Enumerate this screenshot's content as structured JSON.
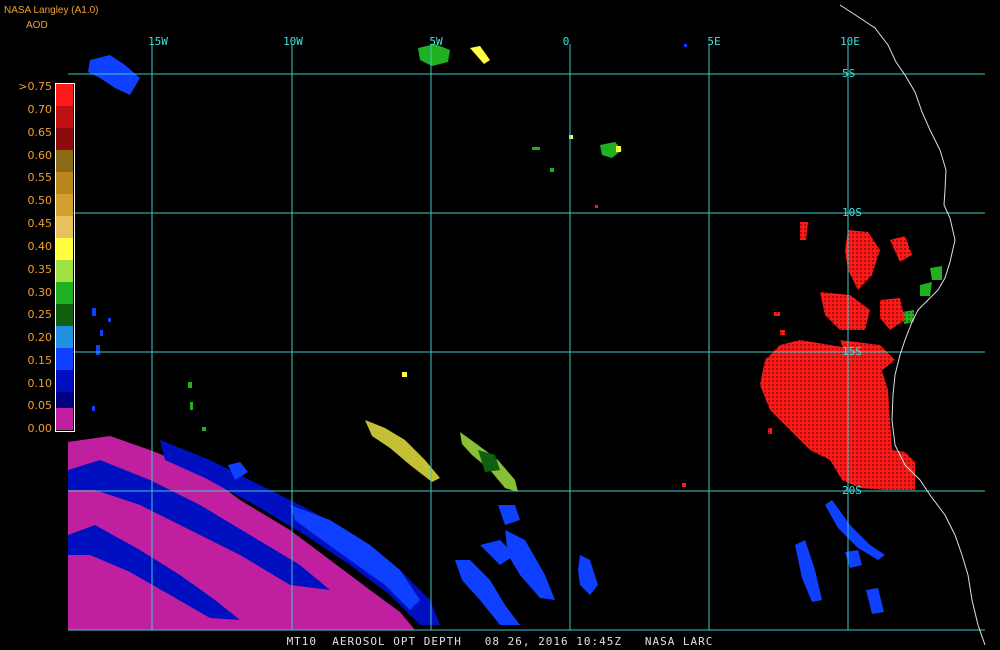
{
  "header": {
    "title": "NASA Langley (A1.0)",
    "variable": "AOD"
  },
  "legend": {
    "ticks": [
      ">0.75",
      "0.70",
      "0.65",
      "0.60",
      "0.55",
      "0.50",
      "0.45",
      "0.40",
      "0.35",
      "0.30",
      "0.25",
      "0.20",
      "0.15",
      "0.10",
      "0.05",
      "0.00"
    ],
    "colors": [
      "#ff1a1a",
      "#c01010",
      "#8b0a0a",
      "#8a6a14",
      "#b8861c",
      "#d4a030",
      "#e8c060",
      "#ffff40",
      "#a0e040",
      "#20b020",
      "#106010",
      "#2090e0",
      "#1040ff",
      "#0010c0",
      "#000080",
      "#c020a0"
    ]
  },
  "grid": {
    "longitudes": [
      "15W",
      "10W",
      "5W",
      "0",
      "5E",
      "10E"
    ],
    "latitudes": [
      "5S",
      "10S",
      "15S",
      "20S"
    ]
  },
  "footer": {
    "text": "MT10  AEROSOL OPT DEPTH   08 26, 2016 10:45Z   NASA LARC"
  }
}
